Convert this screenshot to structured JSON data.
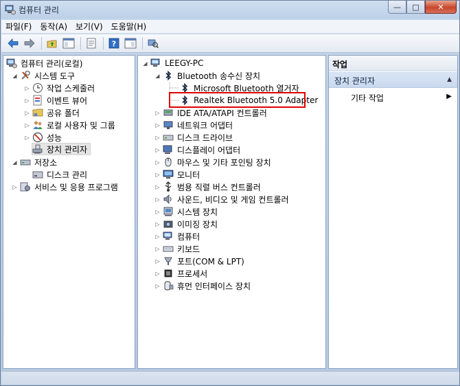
{
  "window": {
    "title": "컴퓨터 관리",
    "minimize": "—",
    "maximize": "□",
    "close": "✕"
  },
  "menu": [
    "파일(F)",
    "동작(A)",
    "보기(V)",
    "도움말(H)"
  ],
  "left_tree": {
    "root": "컴퓨터 관리(로컬)",
    "system_tools": "시스템 도구",
    "task_scheduler": "작업 스케줄러",
    "event_viewer": "이벤트 뷰어",
    "shared_folders": "공유 폴더",
    "local_users": "로컬 사용자 및 그룹",
    "performance": "성능",
    "device_manager": "장치 관리자",
    "storage": "저장소",
    "disk_management": "디스크 관리",
    "services": "서비스 및 응용 프로그램"
  },
  "device_tree": {
    "root": "LEEGY-PC",
    "bluetooth": "Bluetooth 송수신 장치",
    "bt_child_1": "Microsoft Bluetooth 열거자",
    "bt_child_2": "Realtek Bluetooth 5.0 Adapter",
    "categories": [
      "IDE ATA/ATAPI 컨트롤러",
      "네트워크 어댑터",
      "디스크 드라이브",
      "디스플레이 어댑터",
      "마우스 및 기타 포인팅 장치",
      "모니터",
      "범용 직렬 버스 컨트롤러",
      "사운드, 비디오 및 게임 컨트롤러",
      "시스템 장치",
      "이미징 장치",
      "컴퓨터",
      "키보드",
      "포트(COM & LPT)",
      "프로세서",
      "휴먼 인터페이스 장치"
    ]
  },
  "actions": {
    "header": "작업",
    "section": "장치 관리자",
    "more": "기타 작업"
  }
}
